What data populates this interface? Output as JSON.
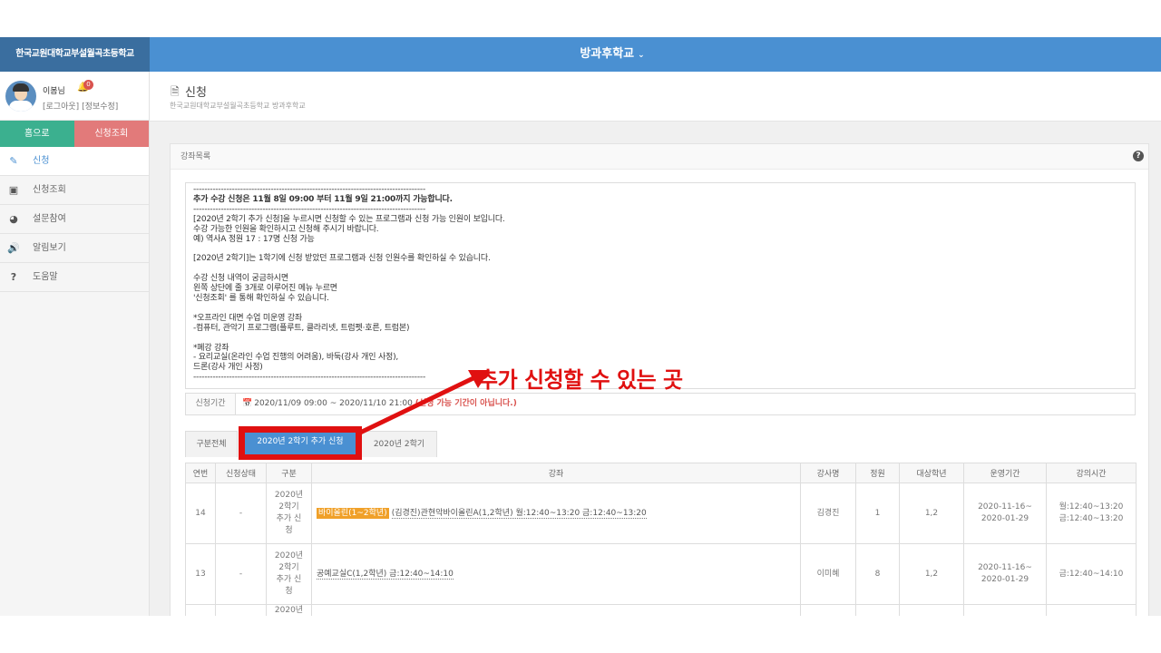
{
  "header": {
    "school_name": "한국교원대학교부설월곡초등학교",
    "app_title": "방과후학교",
    "chevron": "⌄"
  },
  "user": {
    "name": "이봄님",
    "notification_count": "0",
    "logout": "[로그아웃]",
    "edit_info": "[정보수정]"
  },
  "quick_buttons": {
    "home": "홈으로",
    "check": "신청조회"
  },
  "menu": [
    {
      "label": "신청",
      "icon": "edit-icon"
    },
    {
      "label": "신청조회",
      "icon": "picture-icon"
    },
    {
      "label": "설문참여",
      "icon": "pie-chart-icon"
    },
    {
      "label": "알림보기",
      "icon": "volume-icon"
    },
    {
      "label": "도움말",
      "icon": "question-icon"
    }
  ],
  "page": {
    "title": "신청",
    "breadcrumb": "한국교원대학교부설월곡초등학교 방과후학교"
  },
  "panel": {
    "title": "강좌목록"
  },
  "notice_lines": [
    {
      "text": "------------------------------------------------------------------------------------",
      "bold": false
    },
    {
      "text": "추가 수강 신청은 11월 8일 09:00 부터 11월 9일 21:00까지 가능합니다.",
      "bold": true
    },
    {
      "text": "------------------------------------------------------------------------------------",
      "bold": false
    },
    {
      "text": "[2020년 2학기 추가 신청]을 누르시면 신청할 수 있는 프로그램과 신청 가능 인원이 보입니다.",
      "bold": false
    },
    {
      "text": "수강 가능한 인원을 확인하시고 신청해 주시기 바랍니다.",
      "bold": false
    },
    {
      "text": "예) 역사A 정원 17 : 17명 신청 가능",
      "bold": false
    },
    {
      "text": " ",
      "bold": false
    },
    {
      "text": "[2020년 2학기]는 1학기에 신청 받았던 프로그램과 신청 인원수를 확인하실 수 있습니다.",
      "bold": false
    },
    {
      "text": " ",
      "bold": false
    },
    {
      "text": "수강 신청 내역이 궁금하시면",
      "bold": false
    },
    {
      "text": "왼쪽 상단에 줄 3개로 이루어진 메뉴 누르면",
      "bold": false
    },
    {
      "text": "'신청조회' 를 통해 확인하실 수 있습니다.",
      "bold": false
    },
    {
      "text": " ",
      "bold": false
    },
    {
      "text": "*오프라인 대면 수업 미운영 강좌",
      "bold": false
    },
    {
      "text": "-컴퓨터, 관악기 프로그램(플루트, 클라리넷, 트럼펫·호른, 트럼본)",
      "bold": false
    },
    {
      "text": " ",
      "bold": false
    },
    {
      "text": "*폐강 강좌",
      "bold": false
    },
    {
      "text": "- 요리교실(온라인 수업 진행의 어려움), 바둑(강사 개인 사정),",
      "bold": false
    },
    {
      "text": "드론(강사 개인 사정)",
      "bold": false
    },
    {
      "text": "------------------------------------------------------------------------------------",
      "bold": false
    }
  ],
  "period": {
    "label": "신청기간",
    "value": "2020/11/09 09:00 ~ 2020/11/10 21:00",
    "status": "(신청 가능 기간이 아닙니다.)"
  },
  "tabs": [
    "구분전체",
    "2020년 2학기 추가 신청",
    "2020년 2학기"
  ],
  "table": {
    "headers": [
      "연번",
      "신청상태",
      "구분",
      "강좌",
      "강사명",
      "정원",
      "대상학년",
      "운영기간",
      "강의시간"
    ],
    "rows": [
      {
        "no": "14",
        "status": "-",
        "category": "2020년\n2학기\n추가 신\n청",
        "badge": "바이올린(1~2학년)",
        "course": "(김경진)관현악바이올린A(1,2학년) 월:12:40~13:20 금:12:40~13:20",
        "teacher": "김경진",
        "capacity": "1",
        "grade": "1,2",
        "period": "2020-11-16~\n2020-01-29",
        "time": "월:12:40~13:20\n금:12:40~13:20"
      },
      {
        "no": "13",
        "status": "-",
        "category": "2020년\n2학기\n추가 신\n청",
        "badge": "",
        "course": "공예교실C(1,2학년) 금:12:40~14:10",
        "teacher": "이미혜",
        "capacity": "8",
        "grade": "1,2",
        "period": "2020-11-16~\n2020-01-29",
        "time": "금:12:40~14:10"
      }
    ],
    "partial_row_text": "2020년"
  },
  "annotation": {
    "text": "추가 신청할 수 있는 곳",
    "color": "#e01010"
  },
  "colors": {
    "topbar": "#4a90d2",
    "school_bar": "#3a6e9f",
    "home_button": "#3bb08f",
    "check_button": "#e27a7a",
    "badge": "#f0a028"
  }
}
